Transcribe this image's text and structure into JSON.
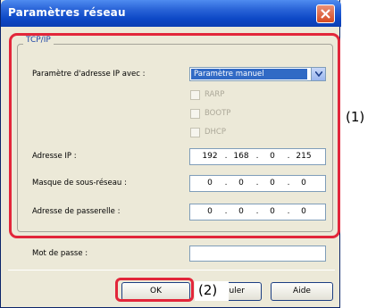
{
  "dialog": {
    "title": "Paramètres réseau"
  },
  "tcpip": {
    "group_label": "TCP/IP",
    "ip_mode_label": "Paramètre d'adresse IP avec :",
    "ip_mode_value": "Paramètre manuel",
    "options": [
      {
        "label": "RARP",
        "checked": false,
        "enabled": false
      },
      {
        "label": "BOOTP",
        "checked": false,
        "enabled": false
      },
      {
        "label": "DHCP",
        "checked": false,
        "enabled": false
      }
    ],
    "ip_address": {
      "label": "Adresse IP :",
      "octets": [
        "192",
        "168",
        "0",
        "215"
      ]
    },
    "subnet_mask": {
      "label": "Masque de sous-réseau :",
      "octets": [
        "0",
        "0",
        "0",
        "0"
      ]
    },
    "gateway": {
      "label": "Adresse de passerelle :",
      "octets": [
        "0",
        "0",
        "0",
        "0"
      ]
    }
  },
  "password": {
    "label": "Mot de passe :",
    "value": ""
  },
  "buttons": {
    "ok": "OK",
    "cancel_visible": "uler",
    "help": "Aide"
  },
  "callouts": {
    "one": "(1)",
    "two": "(2)"
  },
  "colors": {
    "titlebar": "#0d48c6",
    "highlight": "#e2263a",
    "dialog_bg": "#ece9d8",
    "selection": "#316ac5"
  }
}
